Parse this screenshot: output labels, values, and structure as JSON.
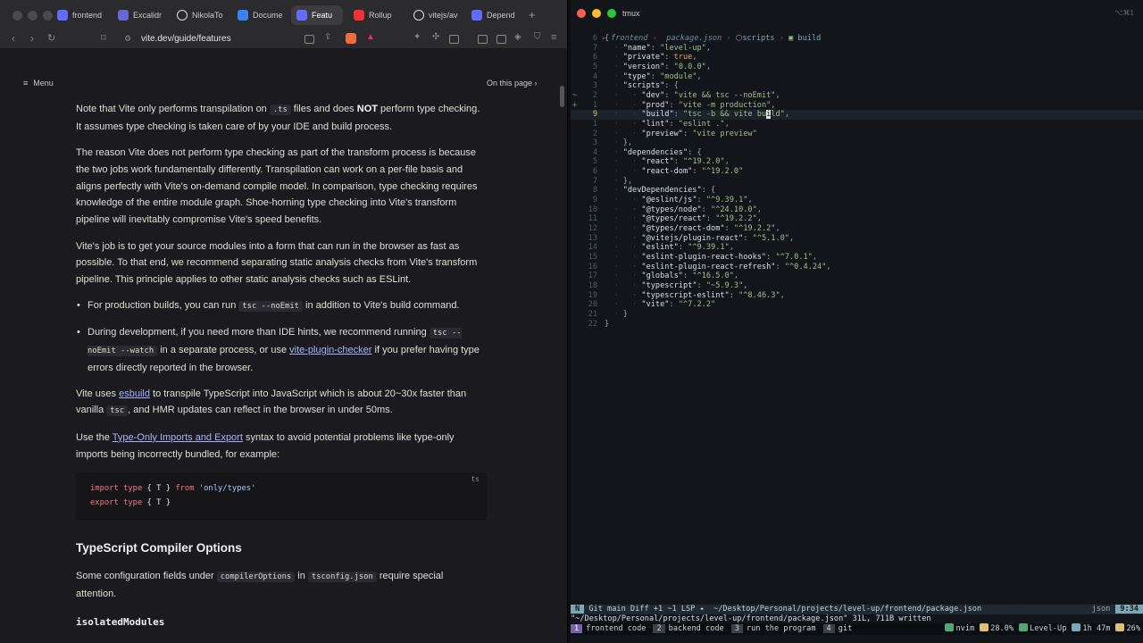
{
  "browser": {
    "tabs": [
      {
        "label": "frontend",
        "icon": "vite-logo-icon",
        "color": "#646cff"
      },
      {
        "label": "Excalidr",
        "icon": "excalidraw-icon",
        "color": "#6965db"
      },
      {
        "label": "NikolaTo",
        "icon": "github-icon",
        "color": "#ffffff"
      },
      {
        "label": "Docume",
        "icon": "docs-icon",
        "color": "#3b82f6"
      },
      {
        "label": "Featu",
        "icon": "vite-logo-icon",
        "color": "#646cff",
        "active": true
      },
      {
        "label": "Rollup",
        "icon": "rollup-icon",
        "color": "#ef3335"
      },
      {
        "label": "vitejs/av",
        "icon": "github-icon",
        "color": "#ffffff"
      },
      {
        "label": "Depend",
        "icon": "vite-logo-icon",
        "color": "#646cff"
      }
    ],
    "new_tab": "+",
    "url": "vite.dev/guide/features",
    "menu_label": "Menu",
    "on_this_page": "On this page ›"
  },
  "article": {
    "p1": {
      "a": "Note that Vite only performs transpilation on ",
      "code": ".ts",
      "b": " files and does ",
      "strong": "NOT",
      "c": " perform type checking. It assumes type checking is taken care of by your IDE and build process."
    },
    "p2": "The reason Vite does not perform type checking as part of the transform process is because the two jobs work fundamentally differently. Transpilation can work on a per-file basis and aligns perfectly with Vite's on-demand compile model. In comparison, type checking requires knowledge of the entire module graph. Shoe-horning type checking into Vite's transform pipeline will inevitably compromise Vite's speed benefits.",
    "p3": "Vite's job is to get your source modules into a form that can run in the browser as fast as possible. To that end, we recommend separating static analysis checks from Vite's transform pipeline. This principle applies to other static analysis checks such as ESLint.",
    "li1": {
      "a": "For production builds, you can run ",
      "code": "tsc --noEmit",
      "b": " in addition to Vite's build command."
    },
    "li2": {
      "a": "During development, if you need more than IDE hints, we recommend running ",
      "code": "tsc --noEmit --watch",
      "b": " in a separate process, or use ",
      "link": "vite-plugin-checker",
      "c": " if you prefer having type errors directly reported in the browser."
    },
    "p4": {
      "a": "Vite uses ",
      "link": "esbuild",
      "b": " to transpile TypeScript into JavaScript which is about 20~30x faster than vanilla ",
      "code": "tsc",
      "c": ", and HMR updates can reflect in the browser in under 50ms."
    },
    "p5": {
      "a": "Use the ",
      "link": "Type-Only Imports and Export",
      "b": " syntax to avoid potential problems like type-only imports being incorrectly bundled, for example:"
    },
    "code_lang": "ts",
    "code_lines": [
      {
        "kw": "import type",
        "mid": " { T } ",
        "kw2": "from",
        "str": " 'only/types'"
      },
      {
        "kw": "export type",
        "mid": " { T }",
        "kw2": "",
        "str": ""
      }
    ],
    "h2": "TypeScript Compiler Options",
    "p6": {
      "a": "Some configuration fields under ",
      "code1": "compilerOptions",
      "b": " in ",
      "code2": "tsconfig.json",
      "c": " require special attention."
    },
    "h3": "isolatedModules"
  },
  "terminal": {
    "title": "tmux",
    "shortcut": "⌥⌘1",
    "breadcrumb": [
      "frontend",
      "package.json",
      "scripts",
      "build"
    ],
    "lines": [
      {
        "n": "6",
        "text": "{"
      },
      {
        "n": "7",
        "key": "\"name\"",
        "val": "\"level-up\"",
        "indent": 1
      },
      {
        "n": "6",
        "key": "\"private\"",
        "bool": "true",
        "indent": 1
      },
      {
        "n": "5",
        "key": "\"version\"",
        "val": "\"0.0.0\"",
        "indent": 1
      },
      {
        "n": "4",
        "key": "\"type\"",
        "val": "\"module\"",
        "indent": 1
      },
      {
        "n": "3",
        "key": "\"scripts\"",
        "open": "{",
        "indent": 1
      },
      {
        "n": "2",
        "key": "\"dev\"",
        "val": "\"vite && tsc --noEmit\"",
        "indent": 2,
        "gutter": "~"
      },
      {
        "n": "1",
        "key": "\"prod\"",
        "val": "\"vite -m production\"",
        "indent": 2,
        "gutter": "+"
      },
      {
        "n": "9",
        "key": "\"build\"",
        "val": "\"tsc -b && vite build\"",
        "indent": 2,
        "current": true
      },
      {
        "n": "1",
        "key": "\"lint\"",
        "val": "\"eslint .\"",
        "indent": 2
      },
      {
        "n": "2",
        "key": "\"preview\"",
        "val": "\"vite preview\"",
        "indent": 2,
        "last": true
      },
      {
        "n": "3",
        "text": "},",
        "indent": 1
      },
      {
        "n": "4",
        "key": "\"dependencies\"",
        "open": "{",
        "indent": 1
      },
      {
        "n": "5",
        "key": "\"react\"",
        "val": "\"^19.2.0\"",
        "indent": 2
      },
      {
        "n": "6",
        "key": "\"react-dom\"",
        "val": "\"^19.2.0\"",
        "indent": 2,
        "last": true
      },
      {
        "n": "7",
        "text": "},",
        "indent": 1
      },
      {
        "n": "8",
        "key": "\"devDependencies\"",
        "open": "{",
        "indent": 1
      },
      {
        "n": "9",
        "key": "\"@eslint/js\"",
        "val": "\"^9.39.1\"",
        "indent": 2
      },
      {
        "n": "10",
        "key": "\"@types/node\"",
        "val": "\"^24.10.0\"",
        "indent": 2
      },
      {
        "n": "11",
        "key": "\"@types/react\"",
        "val": "\"^19.2.2\"",
        "indent": 2
      },
      {
        "n": "12",
        "key": "\"@types/react-dom\"",
        "val": "\"^19.2.2\"",
        "indent": 2
      },
      {
        "n": "13",
        "key": "\"@vitejs/plugin-react\"",
        "val": "\"^5.1.0\"",
        "indent": 2
      },
      {
        "n": "14",
        "key": "\"eslint\"",
        "val": "\"^9.39.1\"",
        "indent": 2
      },
      {
        "n": "15",
        "key": "\"eslint-plugin-react-hooks\"",
        "val": "\"^7.0.1\"",
        "indent": 2
      },
      {
        "n": "16",
        "key": "\"eslint-plugin-react-refresh\"",
        "val": "\"^0.4.24\"",
        "indent": 2
      },
      {
        "n": "17",
        "key": "\"globals\"",
        "val": "\"^16.5.0\"",
        "indent": 2
      },
      {
        "n": "18",
        "key": "\"typescript\"",
        "val": "\"~5.9.3\"",
        "indent": 2
      },
      {
        "n": "19",
        "key": "\"typescript-eslint\"",
        "val": "\"^8.46.3\"",
        "indent": 2
      },
      {
        "n": "20",
        "key": "\"vite\"",
        "val": "\"^7.2.2\"",
        "indent": 2,
        "last": true
      },
      {
        "n": "21",
        "text": "}",
        "indent": 1
      },
      {
        "n": "22",
        "text": "}"
      }
    ],
    "status": {
      "mode": "N",
      "left": " Git main Diff +1 ~1 LSP ✦  ~/Desktop/Personal/projects/level-up/frontend/package.json",
      "filetype": "json",
      "position": "9:34"
    },
    "message": "\"~/Desktop/Personal/projects/level-up/frontend/package.json\" 31L, 711B written",
    "tmux_windows": [
      {
        "n": "1",
        "label": "frontend code",
        "active": true
      },
      {
        "n": "2",
        "label": "backend code"
      },
      {
        "n": "3",
        "label": "run the program"
      },
      {
        "n": "4",
        "label": "git"
      }
    ],
    "tmux_right": [
      {
        "icon": "nvim-icon",
        "label": "nvim",
        "color": "#4fa87a"
      },
      {
        "icon": "cpu-icon",
        "label": "28.0%",
        "color": "#e0c070"
      },
      {
        "icon": "session-icon",
        "label": "Level-Up",
        "color": "#4fa87a"
      },
      {
        "icon": "clock-icon",
        "label": "1h 47m",
        "color": "#7aa7b8"
      },
      {
        "icon": "battery-icon",
        "label": "26%",
        "color": "#e0c070"
      }
    ]
  }
}
